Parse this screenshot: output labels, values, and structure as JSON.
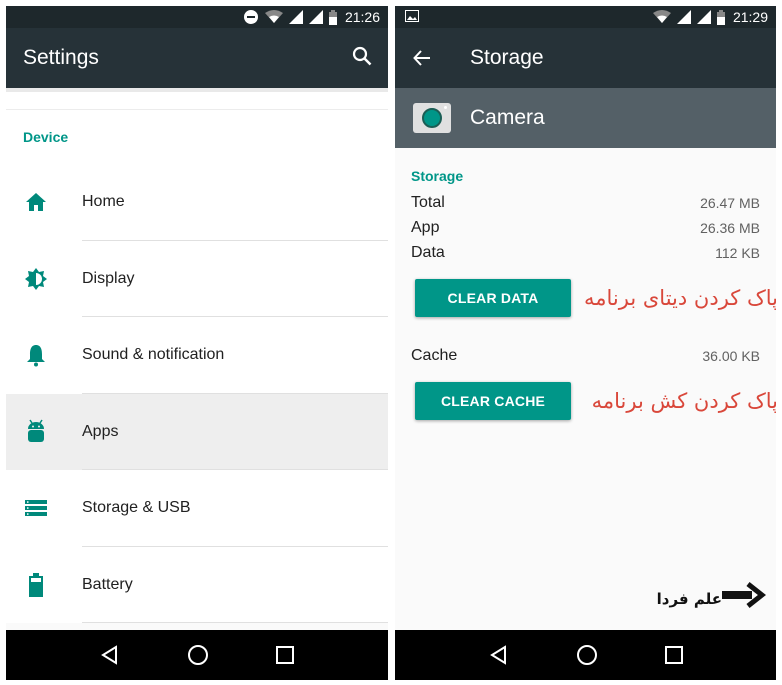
{
  "left": {
    "status": {
      "time": "21:26",
      "icons": [
        "dnd-icon",
        "wifi-icon",
        "signal-icon",
        "signal-icon",
        "battery-icon"
      ]
    },
    "appbar": {
      "title": "Settings",
      "action_icon": "search-icon"
    },
    "section": "Device",
    "items": [
      {
        "label": "Home",
        "icon": "home-icon",
        "active": false
      },
      {
        "label": "Display",
        "icon": "brightness-icon",
        "active": false
      },
      {
        "label": "Sound & notification",
        "icon": "bell-icon",
        "active": false
      },
      {
        "label": "Apps",
        "icon": "android-icon",
        "active": true
      },
      {
        "label": "Storage & USB",
        "icon": "storage-icon",
        "active": false
      },
      {
        "label": "Battery",
        "icon": "battery-icon",
        "active": false
      }
    ],
    "nav": [
      "back-icon",
      "home-circle-icon",
      "recents-icon"
    ]
  },
  "right": {
    "status": {
      "time": "21:29",
      "icons": [
        "image-notification-icon",
        "wifi-icon",
        "signal-icon",
        "signal-icon",
        "battery-icon"
      ]
    },
    "appbar": {
      "title": "Storage",
      "nav_icon": "arrow-back-icon"
    },
    "app": {
      "name": "Camera",
      "icon": "camera-app-icon"
    },
    "storage": {
      "section": "Storage",
      "rows": [
        {
          "label": "Total",
          "value": "26.47 MB"
        },
        {
          "label": "App",
          "value": "26.36 MB"
        },
        {
          "label": "Data",
          "value": "112 KB"
        }
      ],
      "clear_data_label": "CLEAR DATA",
      "clear_data_annotation": "پاک کردن دیتای برنامه",
      "cache": {
        "label": "Cache",
        "value": "36.00 KB"
      },
      "clear_cache_label": "CLEAR CACHE",
      "clear_cache_annotation": "پاک کردن کش برنامه"
    },
    "watermark": "علم فردا",
    "nav": [
      "back-icon",
      "home-circle-icon",
      "recents-icon"
    ]
  },
  "colors": {
    "accent": "#009688",
    "appbar": "#263238",
    "statusbar": "#1e282c",
    "app_header": "#546067",
    "annotation": "#d9473a"
  }
}
